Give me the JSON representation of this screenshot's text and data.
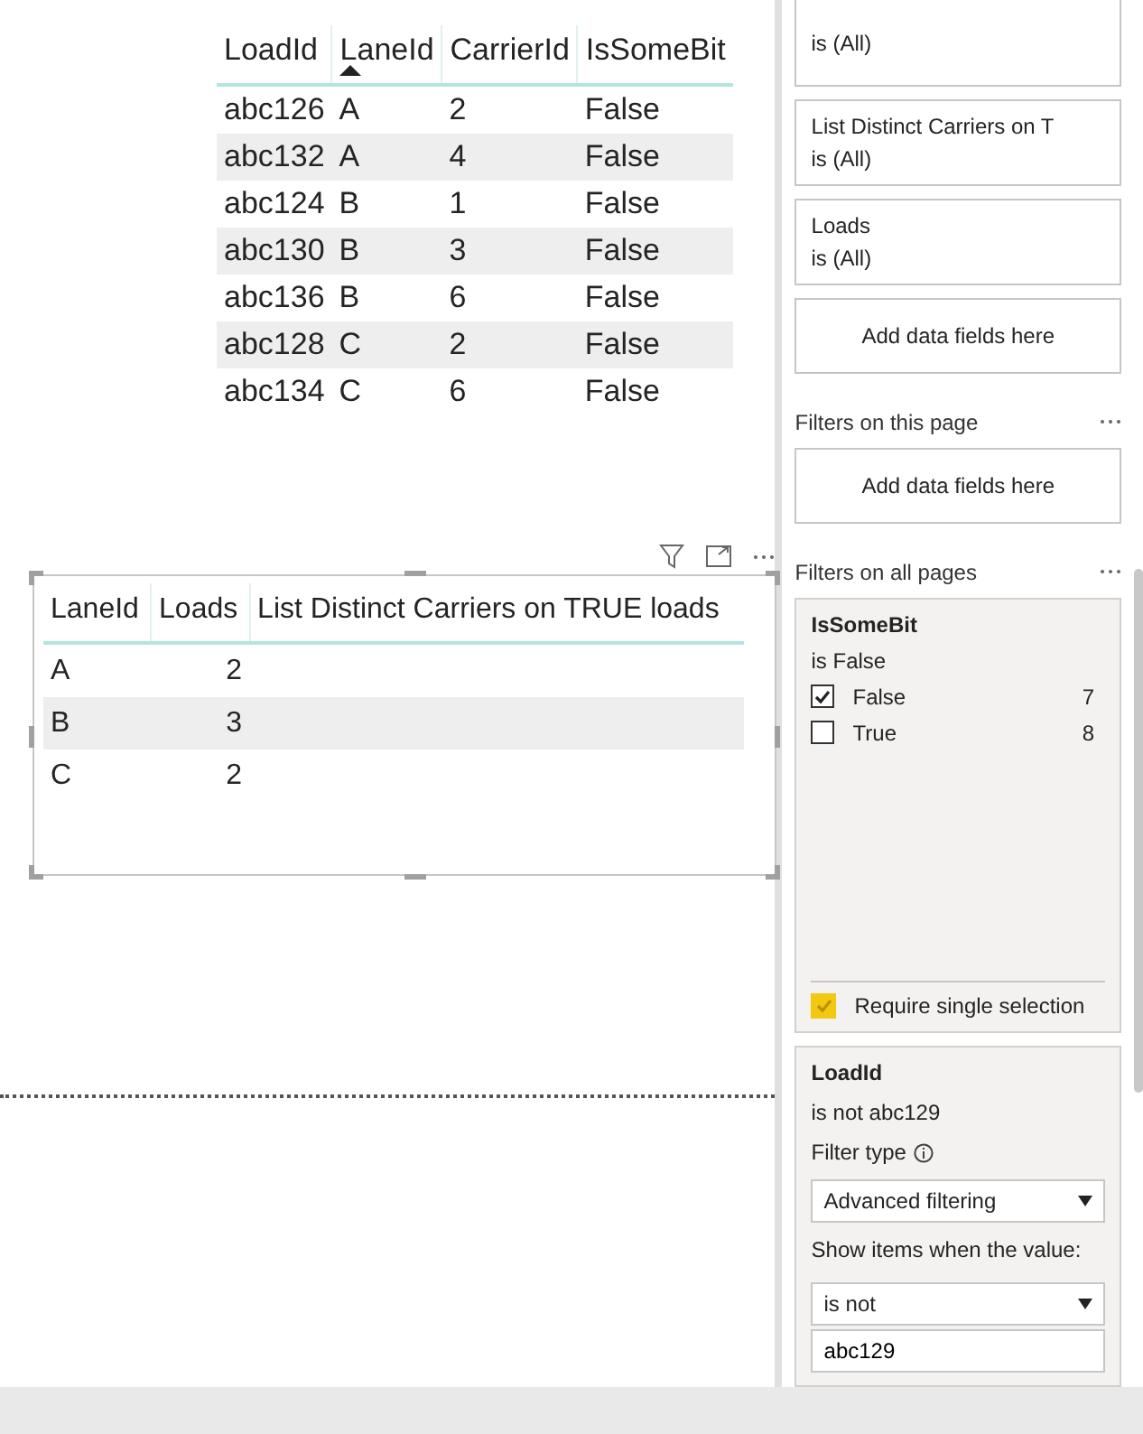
{
  "table_visual": {
    "columns": [
      {
        "label": "LoadId",
        "sorted": false
      },
      {
        "label": "LaneId",
        "sorted": true
      },
      {
        "label": "CarrierId",
        "sorted": false
      },
      {
        "label": "IsSomeBit",
        "sorted": false
      }
    ],
    "rows": [
      [
        "abc126",
        "A",
        "2",
        "False"
      ],
      [
        "abc132",
        "A",
        "4",
        "False"
      ],
      [
        "abc124",
        "B",
        "1",
        "False"
      ],
      [
        "abc130",
        "B",
        "3",
        "False"
      ],
      [
        "abc136",
        "B",
        "6",
        "False"
      ],
      [
        "abc128",
        "C",
        "2",
        "False"
      ],
      [
        "abc134",
        "C",
        "6",
        "False"
      ]
    ]
  },
  "matrix_visual": {
    "selected": true,
    "columns": [
      "LaneId",
      "Loads",
      "List Distinct Carriers on TRUE loads"
    ],
    "rows": [
      {
        "lane": "A",
        "loads": "2"
      },
      {
        "lane": "B",
        "loads": "3"
      },
      {
        "lane": "C",
        "loads": "2"
      }
    ]
  },
  "visual_filters": [
    {
      "kind": "filter",
      "summary": "is (All)"
    },
    {
      "kind": "filter",
      "title": "List Distinct Carriers on T",
      "summary": "is (All)"
    },
    {
      "kind": "filter",
      "title": "Loads",
      "summary": "is (All)"
    },
    {
      "kind": "drop",
      "label": "Add data fields here"
    }
  ],
  "page_filters": {
    "heading": "Filters on this page",
    "drop": "Add data fields here"
  },
  "all_page_filters": {
    "heading": "Filters on all pages",
    "basic": {
      "title": "IsSomeBit",
      "summary": "is False",
      "options": [
        {
          "label": "False",
          "count": "7",
          "checked": true
        },
        {
          "label": "True",
          "count": "8",
          "checked": false
        }
      ],
      "require_single": {
        "label": "Require single selection",
        "checked": true
      }
    },
    "advanced": {
      "title": "LoadId",
      "summary": "is not abc129",
      "filter_type_label": "Filter type",
      "filter_type": "Advanced filtering",
      "show_label": "Show items when the value:",
      "condition": "is not",
      "value": "abc129"
    }
  }
}
